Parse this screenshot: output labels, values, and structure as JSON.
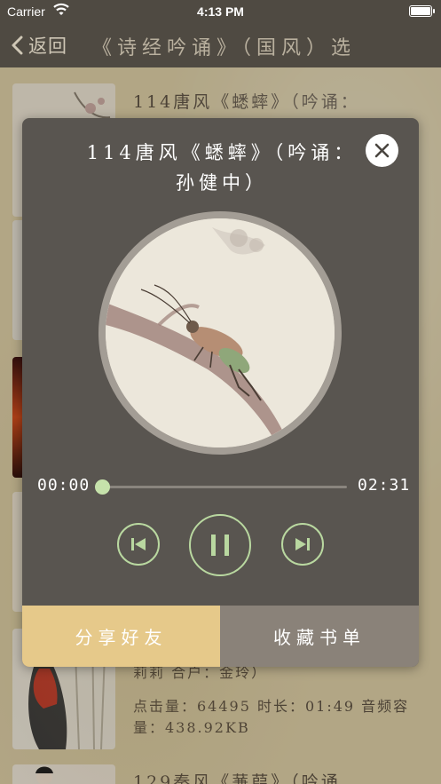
{
  "status_bar": {
    "carrier": "Carrier",
    "time": "4:13 PM"
  },
  "nav": {
    "back_label": "返回",
    "title": "《诗经吟诵》（国风）选"
  },
  "list": {
    "items": [
      {
        "title": "114唐风《蟋蟀》（吟诵：",
        "lines": []
      },
      {
        "title": "",
        "lines": [
          "莉莉 合户：金玲）",
          "点击量：64495 时长：01:49 音频容",
          "量：438.92KB"
        ]
      },
      {
        "title": "129秦风《蒹葭》（吟诵",
        "lines": []
      }
    ]
  },
  "player": {
    "title": "114唐风《蟋蟀》（吟诵：孙健中）",
    "current_time": "00:00",
    "total_time": "02:31",
    "progress": 0,
    "share_label": "分享好友",
    "collect_label": "收藏书单"
  },
  "colors": {
    "accent_green": "#b9d8a0",
    "share_bg": "#e6c98a",
    "collect_bg": "#8a8279",
    "modal_bg": "#595550",
    "nav_bg": "#4f4a42"
  },
  "icons": [
    "wifi-icon",
    "battery-icon",
    "chevron-left-icon",
    "close-icon",
    "skip-previous-icon",
    "pause-icon",
    "skip-next-icon"
  ]
}
